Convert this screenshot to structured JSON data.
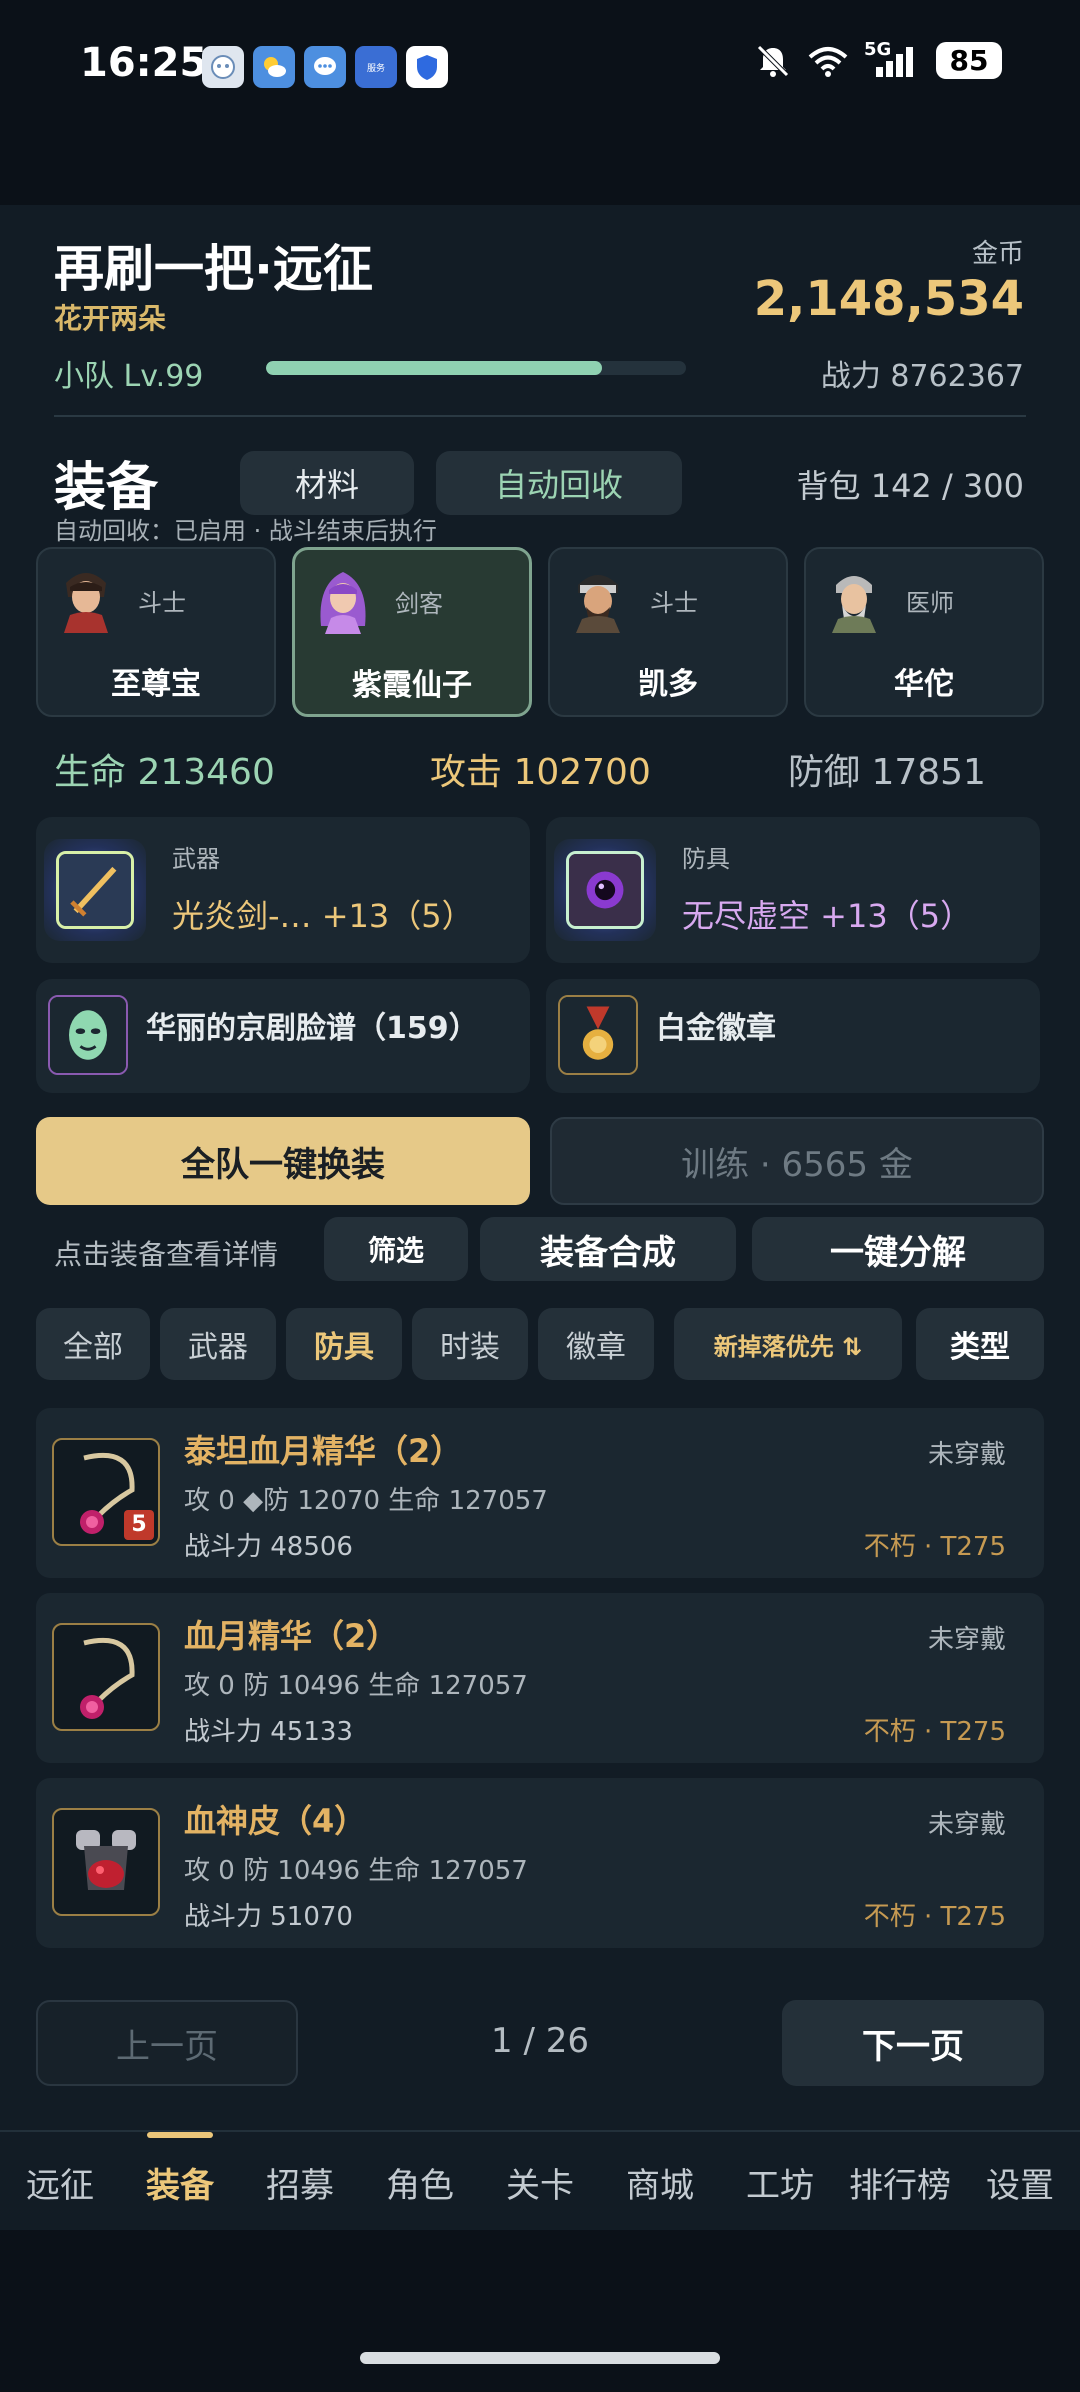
{
  "status_bar": {
    "time": "16:25",
    "battery": "85",
    "network": "5G",
    "app_icons": [
      "chat-bot-icon",
      "weather-icon",
      "messages-icon",
      "service-app-icon",
      "shield-app-icon"
    ],
    "service_app_label": "服务"
  },
  "header": {
    "title": "再刷一把·远征",
    "subtitle": "花开两朵",
    "gold_label": "金币",
    "gold_value": "2,148,534",
    "team_level": "小队 Lv.99",
    "level_progress": 0.8,
    "power": "战力 8762367"
  },
  "equip": {
    "title": "装备",
    "tab_materials": "材料",
    "tab_auto_recycle": "自动回收",
    "bag": "背包 142 / 300",
    "auto_note": "自动回收：已启用 · 战斗结束后执行"
  },
  "heroes": [
    {
      "class": "斗士",
      "name": "至尊宝",
      "selected": false
    },
    {
      "class": "剑客",
      "name": "紫霞仙子",
      "selected": true
    },
    {
      "class": "斗士",
      "name": "凯多",
      "selected": false
    },
    {
      "class": "医师",
      "name": "华佗",
      "selected": false
    }
  ],
  "stats": {
    "hp": "生命 213460",
    "attack": "攻击 102700",
    "defense": "防御 17851"
  },
  "slots": {
    "weapon_cap": "武器",
    "weapon_name": "光炎剑-… +13（5）",
    "armor_cap": "防具",
    "armor_name": "无尽虚空 +13（5）",
    "mask_name": "华丽的京剧脸谱（159）",
    "badge_name": "白金徽章"
  },
  "actions": {
    "equip_all": "全队一键换装",
    "train": "训练 · 6565 金",
    "hint": "点击装备查看详情",
    "filter": "筛选",
    "synthesize": "装备合成",
    "decompose": "一键分解"
  },
  "filters": {
    "all": "全部",
    "weapon": "武器",
    "armor": "防具",
    "fashion": "时装",
    "badge": "徽章",
    "sort": "新掉落优先 ⇅",
    "type": "类型"
  },
  "items": [
    {
      "name": "泰坦血月精华（2）",
      "stats": "攻 0  ◆防 12070  生命 127057",
      "power": "战斗力 48506",
      "status": "未穿戴",
      "tier": "不朽 · T275",
      "badge": "5"
    },
    {
      "name": "血月精华（2）",
      "stats": "攻 0  防 10496  生命 127057",
      "power": "战斗力 45133",
      "status": "未穿戴",
      "tier": "不朽 · T275"
    },
    {
      "name": "血神皮（4）",
      "stats": "攻 0  防 10496  生命 127057",
      "power": "战斗力 51070",
      "status": "未穿戴",
      "tier": "不朽 · T275"
    }
  ],
  "pagination": {
    "prev": "上一页",
    "page": "1 / 26",
    "next": "下一页"
  },
  "nav": {
    "items": [
      "远征",
      "装备",
      "招募",
      "角色",
      "关卡",
      "商城",
      "工坊",
      "排行榜",
      "设置"
    ],
    "active": "装备"
  },
  "colors": {
    "gold": "#ecc77a",
    "accent_green": "#8fd1b1",
    "item_name": "#e3b364",
    "background": "#121c25"
  }
}
